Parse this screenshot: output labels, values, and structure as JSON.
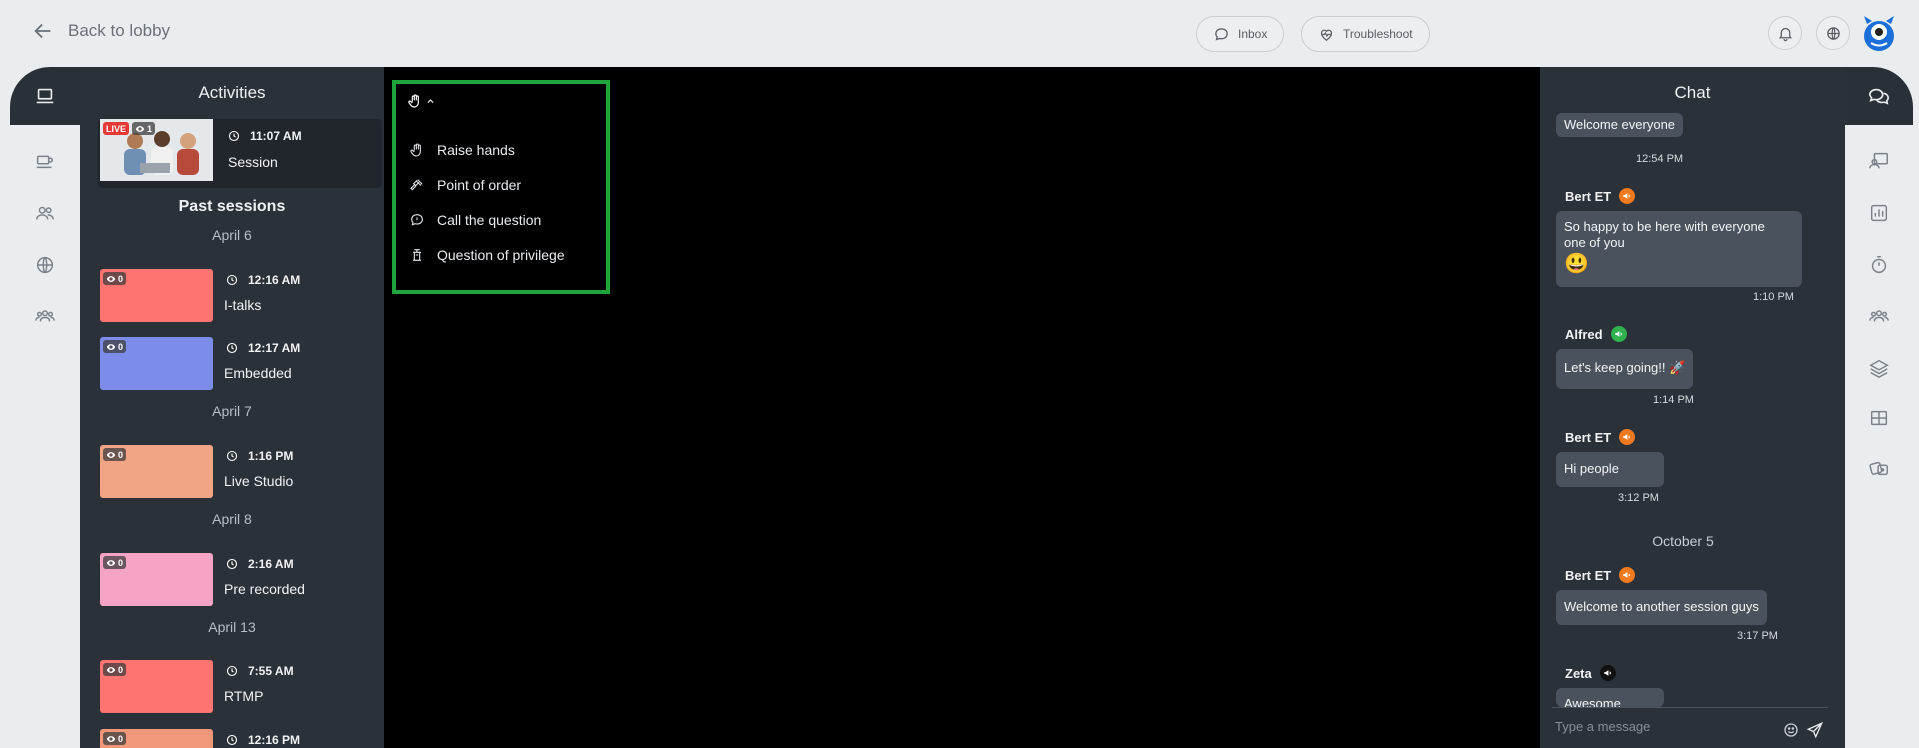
{
  "topbar": {
    "back_label": "Back to lobby",
    "inbox_label": "Inbox",
    "troubleshoot_label": "Troubleshoot",
    "icons": [
      "bell-icon",
      "globe-icon",
      "avatar"
    ]
  },
  "left_nav": {
    "items": [
      "laptop-icon",
      "coffee-icon",
      "people-icon",
      "globe-icon",
      "group-icon"
    ]
  },
  "activities": {
    "title": "Activities",
    "live_session": {
      "badge": "LIVE",
      "viewers": "1",
      "time": "11:07 AM",
      "name": "Session"
    },
    "past_title": "Past sessions",
    "groups": [
      {
        "date": "April 6",
        "sessions": [
          {
            "time": "12:16 AM",
            "name": "I-talks",
            "viewers": "0",
            "color": "#fe7470"
          },
          {
            "time": "12:17 AM",
            "name": "Embedded",
            "viewers": "0",
            "color": "#7b8de9"
          }
        ]
      },
      {
        "date": "April 7",
        "sessions": [
          {
            "time": "1:16 PM",
            "name": "Live Studio",
            "viewers": "0",
            "color": "#f2a585"
          }
        ]
      },
      {
        "date": "April 8",
        "sessions": [
          {
            "time": "2:16 AM",
            "name": "Pre recorded",
            "viewers": "0",
            "color": "#f5a4c5"
          }
        ]
      },
      {
        "date": "April 13",
        "sessions": [
          {
            "time": "7:55 AM",
            "name": "RTMP",
            "viewers": "0",
            "color": "#fe7470"
          },
          {
            "time": "12:16 PM",
            "name": "",
            "viewers": "0",
            "color": "#f2987a"
          }
        ]
      }
    ]
  },
  "hand_menu": {
    "items": [
      "Raise hands",
      "Point of order",
      "Call the question",
      "Question of privilege"
    ]
  },
  "chat": {
    "title": "Chat",
    "messages": [
      {
        "text": "Welcome everyone",
        "time": "12:54 PM"
      },
      {
        "name": "Bert ET",
        "role_color": "#f07a1d",
        "text_line1": "So happy to be here with everyone",
        "text_line2": "one of you",
        "emoji": "😃",
        "time": "1:10 PM"
      },
      {
        "name": "Alfred",
        "role_color": "#2fb24f",
        "text": "Let's keep going!! 🚀",
        "time": "1:14 PM"
      },
      {
        "name": "Bert ET",
        "role_color": "#f07a1d",
        "text": "Hi people",
        "time": "3:12 PM"
      },
      {
        "name": "Bert ET",
        "role_color": "#f07a1d",
        "text": "Welcome to another session guys",
        "time": "3:17 PM"
      },
      {
        "name": "Zeta",
        "role_color": "#111111",
        "text": "Awesome"
      }
    ],
    "date_divider": "October 5",
    "input_placeholder": "Type a message"
  },
  "right_nav": {
    "items": [
      "chat-icon",
      "presenter-icon",
      "poll-icon",
      "timer-icon",
      "group-icon",
      "layers-icon",
      "table-icon",
      "games-icon"
    ]
  }
}
